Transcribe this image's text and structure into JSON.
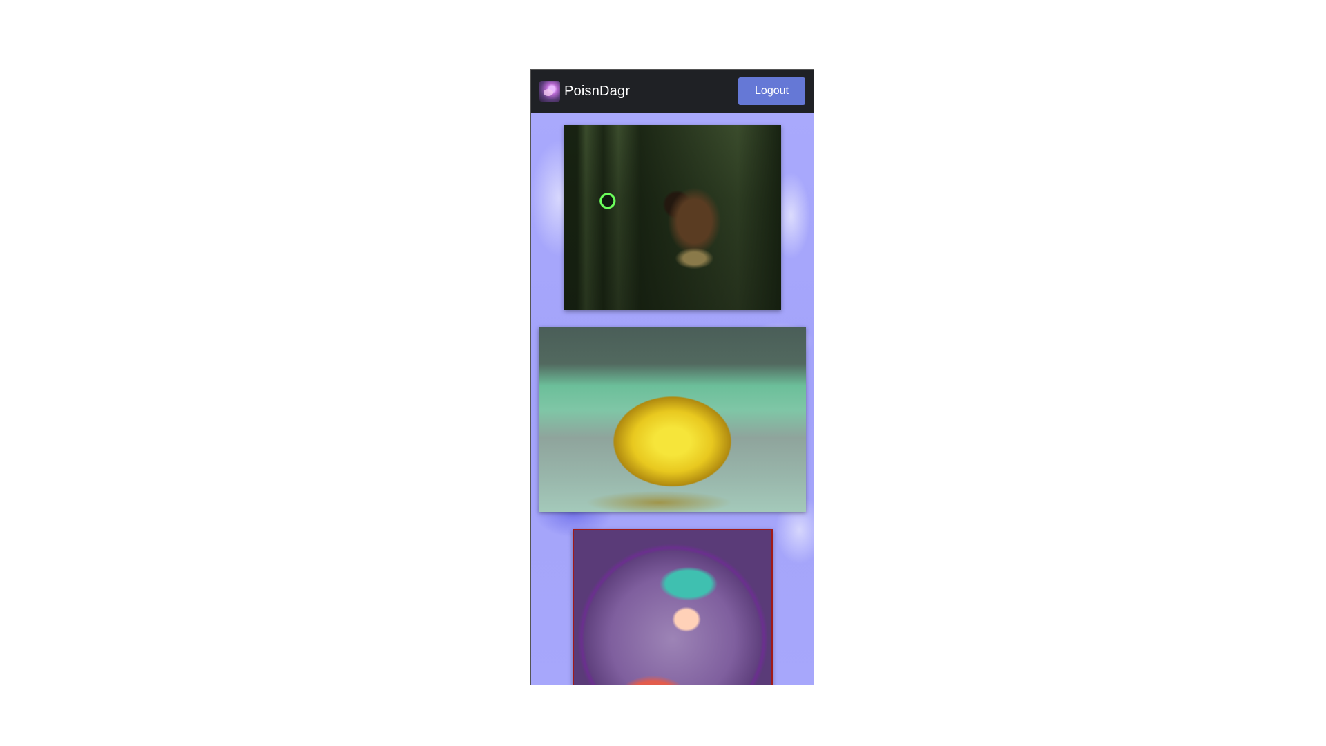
{
  "navbar": {
    "brand_name": "PoisnDagr",
    "logout_label": "Logout"
  },
  "gallery": {
    "items": [
      {
        "icon": "hooded-mage-artwork"
      },
      {
        "icon": "yellow-blob-artwork"
      },
      {
        "icon": "teal-haired-character-artwork"
      }
    ]
  },
  "colors": {
    "navbar_bg": "#1f2125",
    "logout_button_bg": "#6578d6",
    "page_bg": "#a7a7fb"
  }
}
